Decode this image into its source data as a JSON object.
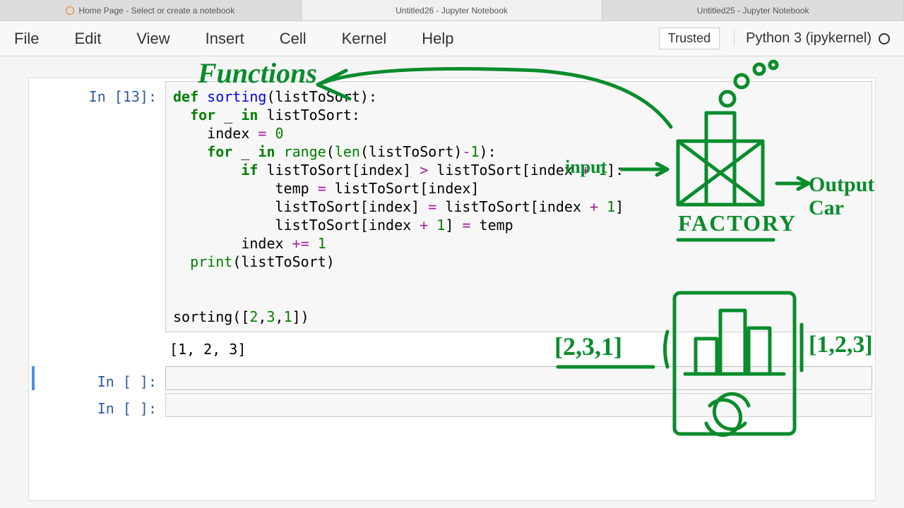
{
  "tabs": [
    {
      "label": "Home Page - Select or create a notebook",
      "active": false
    },
    {
      "label": "Untitled26 - Jupyter Notebook",
      "active": true
    },
    {
      "label": "Untitled25 - Jupyter Notebook",
      "active": false
    }
  ],
  "menu": [
    "File",
    "Edit",
    "View",
    "Insert",
    "Cell",
    "Kernel",
    "Help"
  ],
  "trusted_label": "Trusted",
  "kernel_label": "Python 3 (ipykernel)",
  "cells": [
    {
      "prompt": "In [13]:",
      "code_tokens": [
        {
          "t": "def ",
          "c": "kw-def"
        },
        {
          "t": "sorting",
          "c": "fn-name"
        },
        {
          "t": "(listToSort):\n"
        },
        {
          "t": "  "
        },
        {
          "t": "for",
          "c": "kw-for"
        },
        {
          "t": " _ "
        },
        {
          "t": "in",
          "c": "kw-in"
        },
        {
          "t": " listToSort:\n"
        },
        {
          "t": "    index "
        },
        {
          "t": "=",
          "c": "op"
        },
        {
          "t": " "
        },
        {
          "t": "0",
          "c": "num"
        },
        {
          "t": "\n"
        },
        {
          "t": "    "
        },
        {
          "t": "for",
          "c": "kw-for"
        },
        {
          "t": " _ "
        },
        {
          "t": "in",
          "c": "kw-in"
        },
        {
          "t": " "
        },
        {
          "t": "range",
          "c": "builtin"
        },
        {
          "t": "("
        },
        {
          "t": "len",
          "c": "builtin"
        },
        {
          "t": "(listToSort)"
        },
        {
          "t": "-",
          "c": "op"
        },
        {
          "t": "1",
          "c": "num"
        },
        {
          "t": "):\n"
        },
        {
          "t": "        "
        },
        {
          "t": "if",
          "c": "kw-if"
        },
        {
          "t": " listToSort[index] "
        },
        {
          "t": ">",
          "c": "op"
        },
        {
          "t": " listToSort[index "
        },
        {
          "t": "+",
          "c": "op"
        },
        {
          "t": " "
        },
        {
          "t": "1",
          "c": "num"
        },
        {
          "t": "]:\n"
        },
        {
          "t": "            temp "
        },
        {
          "t": "=",
          "c": "op"
        },
        {
          "t": " listToSort[index]\n"
        },
        {
          "t": "            listToSort[index] "
        },
        {
          "t": "=",
          "c": "op"
        },
        {
          "t": " listToSort[index "
        },
        {
          "t": "+",
          "c": "op"
        },
        {
          "t": " "
        },
        {
          "t": "1",
          "c": "num"
        },
        {
          "t": "]\n"
        },
        {
          "t": "            listToSort[index "
        },
        {
          "t": "+",
          "c": "op"
        },
        {
          "t": " "
        },
        {
          "t": "1",
          "c": "num"
        },
        {
          "t": "] "
        },
        {
          "t": "=",
          "c": "op"
        },
        {
          "t": " temp\n"
        },
        {
          "t": "        index "
        },
        {
          "t": "+=",
          "c": "op"
        },
        {
          "t": " "
        },
        {
          "t": "1",
          "c": "num"
        },
        {
          "t": "\n"
        },
        {
          "t": "  "
        },
        {
          "t": "print",
          "c": "builtin"
        },
        {
          "t": "(listToSort)\n"
        },
        {
          "t": "\n"
        },
        {
          "t": "\n"
        },
        {
          "t": "sorting(["
        },
        {
          "t": "2",
          "c": "num"
        },
        {
          "t": ","
        },
        {
          "t": "3",
          "c": "num"
        },
        {
          "t": ","
        },
        {
          "t": "1",
          "c": "num"
        },
        {
          "t": "])"
        }
      ],
      "output": "[1, 2, 3]"
    },
    {
      "prompt": "In [ ]:",
      "code_tokens": [
        {
          "t": ""
        }
      ],
      "selected": true
    },
    {
      "prompt": "In [ ]:",
      "code_tokens": [
        {
          "t": ""
        }
      ]
    }
  ],
  "annotations": {
    "title": "Functions",
    "input_label": "input",
    "factory_label": "FACTORY",
    "output_label": "Output Car",
    "example_in": "[2,3,1]",
    "example_out": "[1,2,3]"
  },
  "colors": {
    "annotation": "#0a8c2c"
  }
}
